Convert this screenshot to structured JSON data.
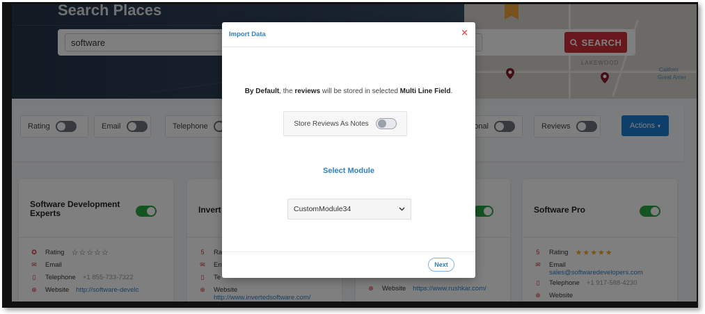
{
  "hero": {
    "title": "Search Places",
    "search_value": "software",
    "search_button": "SEARCH",
    "map_labels": [
      "LAKEWOOD",
      "Californ",
      "Great Amer"
    ]
  },
  "filters": {
    "chips": [
      "Rating",
      "Email",
      "Telephone",
      "onal",
      "Reviews"
    ],
    "actions_label": "Actions"
  },
  "cards": [
    {
      "title": "Software Development Experts",
      "rating_label": "Rating",
      "stars": "☆☆☆☆☆",
      "email_label": "Email",
      "telephone_label": "Telephone",
      "telephone": "+1 855-733-7322",
      "website_label": "Website",
      "website": "http://software-development-experts.com/"
    },
    {
      "title": "Invert",
      "rating_label": "Ra",
      "email_label": "En",
      "telephone_label": "Te",
      "website_label": "Website",
      "website": "http://www.invertedsoftware.com/"
    },
    {
      "website_label": "Website",
      "website": "https://www.rushkar.com/"
    },
    {
      "title": "Software Pro",
      "rating_num": "5",
      "rating_label": "Rating",
      "stars": "★★★★★",
      "email_label": "Email",
      "email": "sales@softwaredevelopers.com",
      "telephone_label": "Telephone",
      "telephone": "+1 917-588-4230",
      "website_label": "Website"
    }
  ],
  "card2_rating_num": "5",
  "modal": {
    "title": "Import Data",
    "close": "×",
    "notice_bold1": "By Default",
    "notice_part2": ", the ",
    "notice_bold2": "reviews",
    "notice_part3": " will be stored in selected ",
    "notice_bold3": "Multi Line Field",
    "notice_end": ".",
    "store_label": "Store Reviews As Notes",
    "select_module_label": "Select Module",
    "module_value": "CustomModule34",
    "next_label": "Next"
  }
}
